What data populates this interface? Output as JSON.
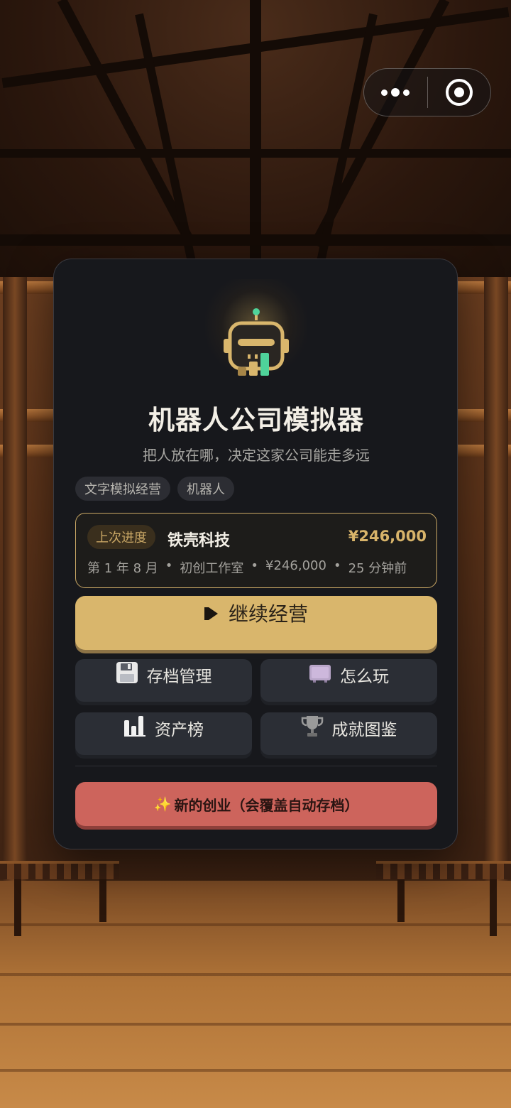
{
  "app": {
    "title": "机器人公司模拟器",
    "subtitle": "把人放在哪，决定这家公司能走多远",
    "tags": [
      "文字模拟经营",
      "机器人"
    ]
  },
  "last_progress": {
    "badge": "上次进度",
    "company": "铁壳科技",
    "money": "¥246,000",
    "meta": [
      "第 1 年 8 月",
      "初创工作室",
      "¥246,000",
      "25 分钟前"
    ],
    "separator": "•"
  },
  "buttons": {
    "continue": "继续经营",
    "save_manage": "存档管理",
    "how_to_play": "怎么玩",
    "leaderboard": "资产榜",
    "achievements": "成就图鉴",
    "new_game": "新的创业（会覆盖自动存档）",
    "new_game_icon": "✨"
  },
  "icons": {
    "logo": "robot-logo-icon",
    "continue": "play-icon",
    "save_manage": "floppy-disk-icon",
    "how_to_play": "screen-icon",
    "leaderboard": "bar-chart-icon",
    "achievements": "trophy-icon",
    "capsule_more": "more-dots-icon",
    "capsule_close": "close-target-icon"
  },
  "colors": {
    "card_bg": "#17181c",
    "accent_gold": "#d9b66c",
    "danger_red": "#cd645c",
    "button_dark": "#2b2e35"
  }
}
